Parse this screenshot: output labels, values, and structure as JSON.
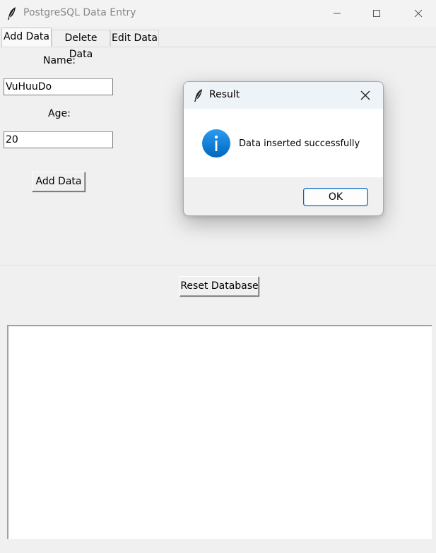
{
  "window": {
    "title": "PostgreSQL Data Entry"
  },
  "tabs": [
    {
      "label": "Add Data",
      "selected": true
    },
    {
      "label": "Delete Data",
      "selected": false
    },
    {
      "label": "Edit Data",
      "selected": false
    }
  ],
  "form": {
    "name_label": "Name:",
    "name_value": "VuHuuDo",
    "age_label": "Age:",
    "age_value": "20",
    "add_button": "Add Data"
  },
  "reset_button": "Reset Database",
  "output_text": "",
  "dialog": {
    "title": "Result",
    "message": "Data inserted successfully",
    "ok_button": "OK",
    "icon": "info-icon",
    "accent": "#0078d4"
  },
  "icons": {
    "app": "feather-icon"
  }
}
